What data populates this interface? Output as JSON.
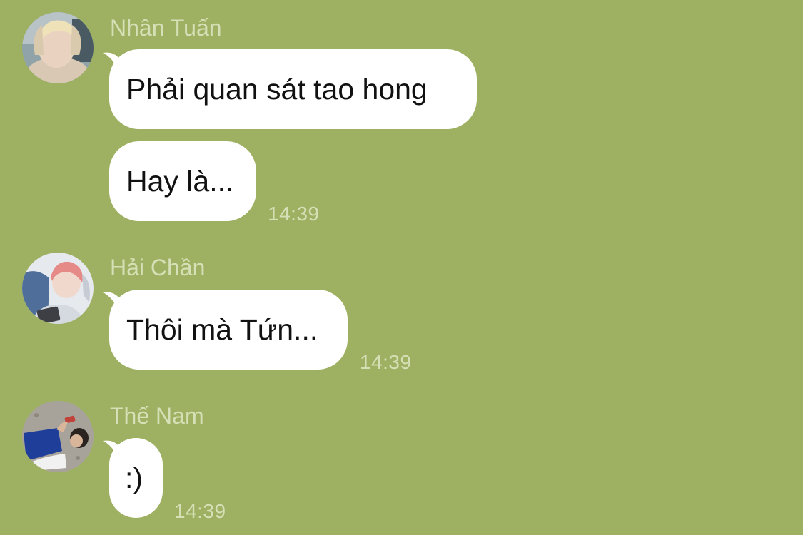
{
  "colors": {
    "background": "#9eb162",
    "bubble": "#ffffff",
    "meta_text": "#d6e0b6",
    "message_text": "#111111"
  },
  "groups": [
    {
      "sender": "Nhân Tuấn",
      "avatar": "avatar-nhan-tuan",
      "messages": [
        "Phải quan sát tao hong",
        "Hay là..."
      ],
      "time": "14:39"
    },
    {
      "sender": "Hải Chần",
      "avatar": "avatar-hai-chan",
      "messages": [
        "Thôi mà Tứn..."
      ],
      "time": "14:39"
    },
    {
      "sender": "Thế Nam",
      "avatar": "avatar-the-nam",
      "messages": [
        ":)"
      ],
      "time": "14:39"
    }
  ]
}
